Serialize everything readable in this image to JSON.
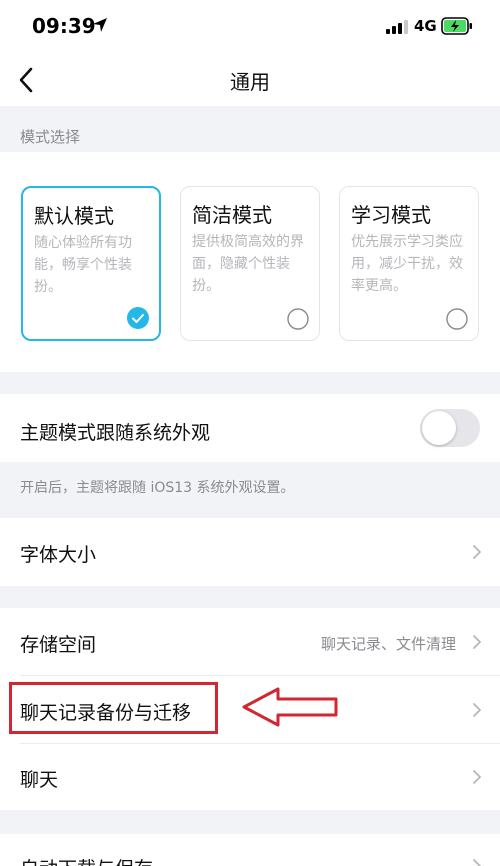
{
  "status_bar": {
    "time": "09:39",
    "network": "4G"
  },
  "nav": {
    "title": "通用"
  },
  "mode_section": {
    "header": "模式选择",
    "cards": [
      {
        "title": "默认模式",
        "desc": "随心体验所有功能，畅享个性装扮。",
        "selected": true
      },
      {
        "title": "简洁模式",
        "desc": "提供极简高效的界面，隐藏个性装扮。",
        "selected": false
      },
      {
        "title": "学习模式",
        "desc": "优先展示学习类应用，减少干扰，效率更高。",
        "selected": false
      }
    ]
  },
  "theme": {
    "label": "主题模式跟随系统外观",
    "toggle_on": false,
    "hint": "开启后，主题将跟随 iOS13 系统外观设置。"
  },
  "rows": {
    "font_size": {
      "label": "字体大小"
    },
    "storage": {
      "label": "存储空间",
      "value": "聊天记录、文件清理"
    },
    "chat_backup": {
      "label": "聊天记录备份与迁移"
    },
    "chat": {
      "label": "聊天"
    },
    "auto_download": {
      "label": "自动下载与保存"
    }
  },
  "colors": {
    "accent": "#25b7e6",
    "annotation": "#d22630",
    "background": "#f2f3f7"
  }
}
